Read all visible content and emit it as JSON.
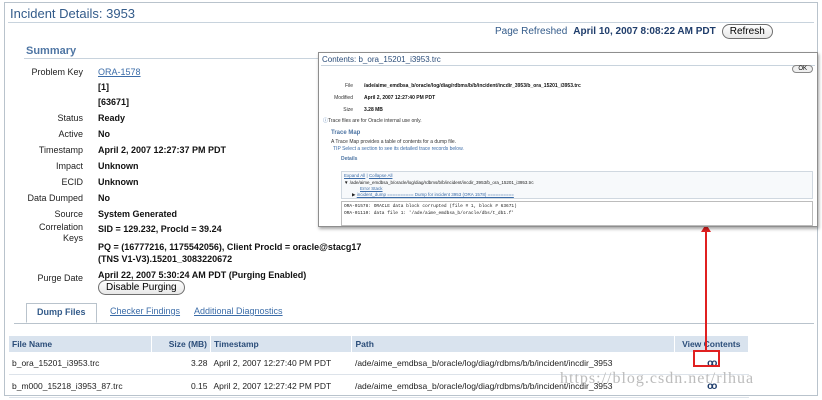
{
  "page": {
    "title": "Incident Details: 3953",
    "refresh_label": "Page Refreshed",
    "refresh_time": "April 10, 2007 8:08:22 AM PDT",
    "refresh_button": "Refresh"
  },
  "summary": {
    "heading": "Summary",
    "problem_key_label": "Problem Key",
    "problem_key_link": "ORA-1578",
    "problem_key_line2": "[1]",
    "problem_key_line3": "[63671]",
    "status_label": "Status",
    "status_value": "Ready",
    "active_label": "Active",
    "active_value": "No",
    "timestamp_label": "Timestamp",
    "timestamp_value": "April 2, 2007 12:27:37 PM PDT",
    "impact_label": "Impact",
    "impact_value": "Unknown",
    "ecid_label": "ECID",
    "ecid_value": "Unknown",
    "data_dumped_label": "Data Dumped",
    "data_dumped_value": "No",
    "source_label": "Source",
    "source_value": "System Generated",
    "correlation_label_1": "Correlation",
    "correlation_label_2": "Keys",
    "correlation_line1": "SID = 129.232, ProcId = 39.24",
    "correlation_line2": "PQ = (16777216, 1175542056), Client ProcId = oracle@stacg17",
    "correlation_line3": "(TNS V1-V3).15201_3083220672",
    "purge_label": "Purge Date",
    "purge_value": "April 22, 2007 5:30:24 AM PDT (Purging Enabled)",
    "disable_purging_button": "Disable Purging"
  },
  "tabs": {
    "dump_files": "Dump Files",
    "checker_findings": "Checker Findings",
    "additional_diagnostics": "Additional Diagnostics"
  },
  "table": {
    "headers": [
      "File Name",
      "Size (MB)",
      "Timestamp",
      "Path",
      "View Contents"
    ],
    "rows": [
      [
        "b_ora_15201_i3953.trc",
        "3.28",
        "April 2, 2007 12:27:40 PM PDT",
        "/ade/aime_emdbsa_b/oracle/log/diag/rdbms/b/b/incident/incdir_3953"
      ],
      [
        "b_m000_15218_i3953_87.trc",
        "0.15",
        "April 2, 2007 12:27:42 PM PDT",
        "/ade/aime_emdbsa_b/oracle/log/diag/rdbms/b/b/incident/incdir_3953"
      ]
    ]
  },
  "popup": {
    "title": "Contents: b_ora_15201_i3953.trc",
    "ok_button": "OK",
    "file_label": "File",
    "file_value": "/ade/aime_emdbsa_b/oracle/log/diag/rdbms/b/b/incident/incdir_3953/b_ora_15201_i3953.trc",
    "modified_label": "Modified",
    "modified_value": "April 2, 2007 12:27:40 PM PDT",
    "size_label": "Size",
    "size_value": "3.28 MB",
    "note": "Trace files are for Oracle internal use only.",
    "trace_map_heading": "Trace Map",
    "trace_map_desc": "A Trace Map provides a table of contents for a dump file.",
    "tip": "TIP Select a section to see its detailed trace records below.",
    "details_heading": "Details",
    "expand_all": "Expand All",
    "collapse_all": "Collapse All",
    "tree_line1": "/ade/aime_emdbsa_b/oracle/log/diag/rdbms/b/b/incident/incdir_3953/b_ora_15201_i3953.trc",
    "tree_line2": "Error Stack",
    "tree_line3": "incident_dump ========== Dump for incident 3953 (ORA 1578) ==========",
    "out_line1": "ORA-01578: ORACLE data block corrupted (file # 1, block # 63671)",
    "out_line2": "ORA-01110: data file 1: '/ade/aime_emdbsa_b/oracle/dbs/t_db1.f'"
  },
  "watermark": "https://blog.csdn.net/rlhua",
  "colors": {
    "accent": "#335b8a",
    "highlight": "#e02020",
    "header_bg": "#d9e3ee"
  }
}
